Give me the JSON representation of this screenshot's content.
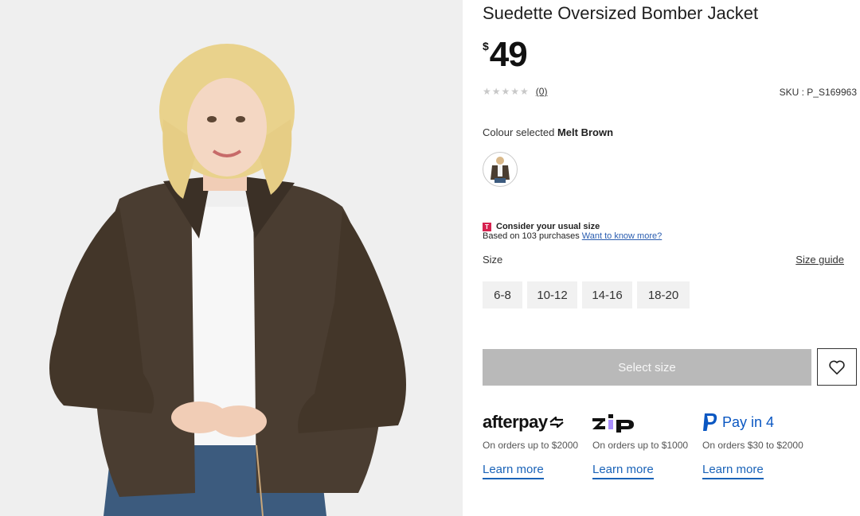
{
  "product": {
    "title": "Suedette Oversized Bomber Jacket",
    "currency_symbol": "$",
    "price": "49",
    "rating_stars": "★★★★★",
    "review_count": "(0)",
    "sku": "SKU : P_S169963"
  },
  "colour": {
    "label": "Colour selected",
    "value": "Melt Brown"
  },
  "fit_advice": {
    "badge": "T",
    "heading": "Consider your usual size",
    "text": "Based on 103 purchases",
    "link": "Want to know more?"
  },
  "size": {
    "label": "Size",
    "guide_link": "Size guide",
    "options": [
      "6-8",
      "10-12",
      "14-16",
      "18-20"
    ]
  },
  "actions": {
    "select_size": "Select size"
  },
  "payments": [
    {
      "name": "afterpay",
      "description": "On orders up to $2000",
      "learn_more": "Learn more"
    },
    {
      "name": "zip",
      "description": "On orders up to $1000",
      "learn_more": "Learn more"
    },
    {
      "name": "Pay in 4",
      "description": "On orders $30 to $2000",
      "learn_more": "Learn more"
    }
  ],
  "colors": {
    "accent_link": "#1a63b8",
    "disabled_button": "#b9b9b9",
    "fit_badge": "#d6224f",
    "jacket": "#4a3d31"
  },
  "icons": {
    "wishlist": "heart-icon",
    "paypal": "paypal-icon",
    "afterpay": "afterpay-arrows-icon"
  }
}
